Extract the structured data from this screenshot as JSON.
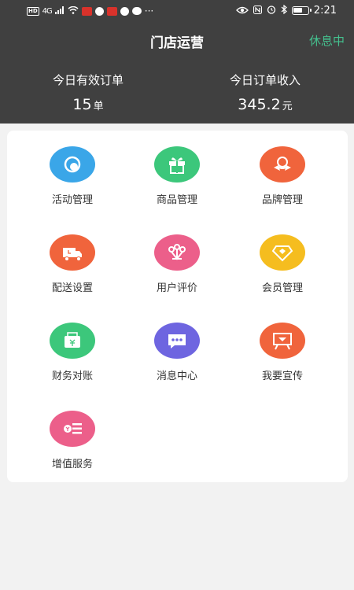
{
  "status_bar": {
    "network": "4G",
    "time": "2:21",
    "more": "···"
  },
  "header": {
    "title": "门店运营",
    "status_button": "休息中"
  },
  "stats": {
    "orders": {
      "label": "今日有效订单",
      "value": "15",
      "unit": "单"
    },
    "income": {
      "label": "今日订单收入",
      "value": "345.2",
      "unit": "元"
    }
  },
  "menu": {
    "items": [
      {
        "label": "活动管理",
        "icon": "activity-icon",
        "color": "#3aa6e8"
      },
      {
        "label": "商品管理",
        "icon": "gift-icon",
        "color": "#3cc77b"
      },
      {
        "label": "品牌管理",
        "icon": "ribbon-badge-icon",
        "color": "#f0643c"
      },
      {
        "label": "配送设置",
        "icon": "delivery-truck-icon",
        "color": "#f0643c"
      },
      {
        "label": "用户评价",
        "icon": "flowers-icon",
        "color": "#ec5f8a"
      },
      {
        "label": "会员管理",
        "icon": "diamond-icon",
        "color": "#f5bd1f"
      },
      {
        "label": "财务对账",
        "icon": "wallet-icon",
        "color": "#3cc77b"
      },
      {
        "label": "消息中心",
        "icon": "message-bubble-icon",
        "color": "#6e65e0"
      },
      {
        "label": "我要宣传",
        "icon": "billboard-icon",
        "color": "#f0643c"
      },
      {
        "label": "增值服务",
        "icon": "coin-stack-icon",
        "color": "#ec5f8a"
      }
    ]
  }
}
